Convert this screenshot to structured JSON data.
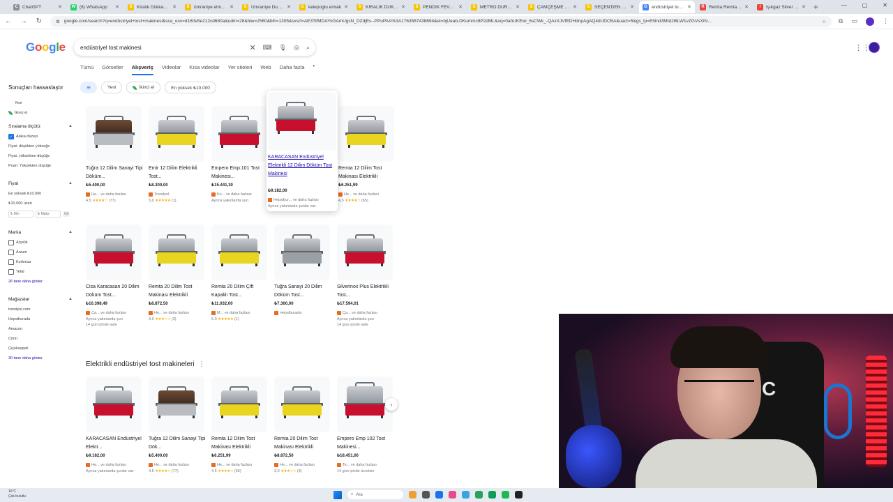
{
  "browser": {
    "tabs": [
      {
        "label": "ChatGPT",
        "color": "#8e8e8e",
        "glyph": "C"
      },
      {
        "label": "(8) WhatsApp",
        "color": "#25d366",
        "glyph": "W"
      },
      {
        "label": "Kiralık Dükkan &",
        "color": "#f5c400",
        "glyph": "S"
      },
      {
        "label": "ümraniye elmalık",
        "color": "#f5c400",
        "glyph": "S"
      },
      {
        "label": "Ümraniye Dumlu",
        "color": "#f5c400",
        "glyph": "S"
      },
      {
        "label": "kelepoglu emlak",
        "color": "#f5c400",
        "glyph": "S"
      },
      {
        "label": "KİRALIK DÜKKAN",
        "color": "#f5c400",
        "glyph": "S"
      },
      {
        "label": "PENDİK FEVZİ Ç",
        "color": "#f5c400",
        "glyph": "S"
      },
      {
        "label": "METRO DURAĞI",
        "color": "#f5c400",
        "glyph": "S"
      },
      {
        "label": "ÇAMÇEŞME MAH",
        "color": "#f5c400",
        "glyph": "S"
      },
      {
        "label": "SEÇEN'DEN MAĞ",
        "color": "#f5c400",
        "glyph": "S"
      },
      {
        "label": "endüstriyel tost n",
        "color": "#4285f4",
        "glyph": "G",
        "active": true
      },
      {
        "label": "Remta Remta Yo",
        "color": "#e8453c",
        "glyph": "R"
      },
      {
        "label": "Işıkgaz Silver End",
        "color": "#ea4335",
        "glyph": "I"
      }
    ],
    "url": "google.com/search?q=endüstriyel+tost+makinesi&sca_esv=d160e5e212cd680a&udm=28&biw=2560&bih=1305&sxsrf=AE3TifMDAYvGAmUgsN_DZdjEs--PPuPAA%3A1763587438694&ei=bjUeab-DKummc8P2dML&oq=0ahUKEwi_6sCWk_-QAxXJVfEDHdnpAgAQ4dUDCBA&uact=5&gs_lp=Ehlnd3Mtd2l6LW1vZGVsXIN..."
  },
  "search": {
    "query": "endüstriyel tost makinesi",
    "logo": [
      "G",
      "o",
      "o",
      "g",
      "l",
      "e"
    ],
    "logo_colors": [
      "#4285f4",
      "#ea4335",
      "#fbbc05",
      "#4285f4",
      "#34a853",
      "#ea4335"
    ]
  },
  "navtabs": [
    "Tümü",
    "Görseller",
    "Alışveriş",
    "Videolar",
    "Kısa videolar",
    "Yer siteleri",
    "Web",
    "Daha fazla"
  ],
  "navtabs_active": 2,
  "chips": [
    "Yeni",
    "İkinci el",
    "En yüksek ₺10.000"
  ],
  "sidebar": {
    "title": "Sonuçları hassaslaştır",
    "condition": [
      "Yeni",
      "İkinci el"
    ],
    "sort_heading": "Sıralama ölçütü:",
    "sort_options": [
      "Alaka düzeyi",
      "Fiyat: düşükten yükseğe",
      "Fiyat: yüksekten düşüğe",
      "Puan: Yüksekten düşüğe"
    ],
    "price_heading": "Fiyat",
    "price_options": [
      "En yüksek ₺10.000",
      "₺10.000 üzeri"
    ],
    "price_min": "₺ Min",
    "price_max": "₺ Maks",
    "price_go": "Git",
    "brand_heading": "Marka",
    "brands": [
      "Arçelik",
      "Arzum",
      "Korkmaz",
      "Tefal"
    ],
    "brands_more": "26 tane daha göster",
    "store_heading": "Mağazalar",
    "stores": [
      "trendyol.com",
      "Hepsiburada",
      "Amazon",
      "Cimri",
      "Çiçeksepeti"
    ],
    "stores_more": "30 tane daha göster"
  },
  "products_row1": [
    {
      "name": "Tuğra 12 Dilim Sanayi Tipi Döküm...",
      "price": "₺5.400,00",
      "store": "He... ve daha fazlası",
      "rating": "4,5",
      "stars": "★★★★☆",
      "count": "(77)",
      "style": "brown"
    },
    {
      "name": "Emir 12 Dilim Elektrikli Tost...",
      "price": "₺8.300,00",
      "store": "Trendyol",
      "rating": "5,0",
      "stars": "★★★★★",
      "count": "(1)",
      "style": "yellow"
    },
    {
      "name": "Empero Emp.101 Tost Makinesi...",
      "price": "₺15.441,30",
      "store": "Ko... ve daha fazlası",
      "rating": "",
      "stars": "",
      "count": "",
      "extra": "Ayrıca yakınlarda şun",
      "style": "red"
    },
    {
      "name": "KARACASAN Endüstriyel Elektrikli 12 Dilim Döküm Tost Makinesi",
      "price": "₺9.182,00",
      "store": "Hepsibur... ve daha fazlası",
      "rating": "",
      "stars": "",
      "count": "",
      "extra": "Ayrıca yakınlarda şunlar var:",
      "style": "red",
      "hover": true
    },
    {
      "name": "Remta 12 Dilim Tost Makinası Elektrikli",
      "price": "₺6.251,99",
      "store": "He... ve daha fazlası",
      "rating": "4,5",
      "stars": "★★★★☆",
      "count": "(65)",
      "style": "yellow"
    }
  ],
  "products_row2": [
    {
      "name": "Cisa Karacasan 20 Dilim Döküm Tost...",
      "price": "₺10.398,49",
      "store": "Ça... ve daha fazlası",
      "rating": "",
      "stars": "",
      "count": "",
      "extra": "Ayrıca yakınlarda şun",
      "extra2": "14 gün içinde iade",
      "style": "red"
    },
    {
      "name": "Remta 20 Dilim Tost Makinası Elektrikli",
      "price": "₺8.872,50",
      "store": "He... ve daha fazlası",
      "rating": "3,0",
      "stars": "★★★☆☆",
      "count": "(3)",
      "style": "yellow"
    },
    {
      "name": "Remta 20 Dilim Çift Kapaklı Tost...",
      "price": "₺11.032,00",
      "store": "M... ve daha fazlası",
      "rating": "5,0",
      "stars": "★★★★★",
      "count": "(1)",
      "style": "yellow"
    },
    {
      "name": "Tuğra Sanayi 20 Dilim Döküm Tost...",
      "price": "₺7.300,00",
      "store": "Hepsiburada",
      "rating": "",
      "stars": "",
      "count": "",
      "style": "silver"
    },
    {
      "name": "Silverinox Plus Elektrikli Tost...",
      "price": "₺17.594,01",
      "store": "Ça... ve daha fazlası",
      "rating": "",
      "stars": "",
      "count": "",
      "extra": "Ayrıca yakınlarda şun",
      "extra2": "14 gün içinde iade",
      "style": "red"
    }
  ],
  "section_title": "Elektrikli endüstriyel tost makineleri",
  "products_row3": [
    {
      "name": "KARACASAN Endüstriyel Elektr...",
      "price": "₺9.182,00",
      "store": "He... ve daha fazlası",
      "extra": "Ayrıca yakınlarda şunlar var:",
      "style": "red"
    },
    {
      "name": "Tuğra 12 Dilim Sanayi Tipi Dök...",
      "price": "₺5.400,00",
      "store": "He... ve daha fazlası",
      "rating": "4,5",
      "stars": "★★★★☆",
      "count": "(77)",
      "style": "brown"
    },
    {
      "name": "Remta 12 Dilim Tost Makinası Elektrikli",
      "price": "₺6.251,99",
      "store": "He... ve daha fazlası",
      "rating": "4,5",
      "stars": "★★★★☆",
      "count": "(65)",
      "style": "yellow"
    },
    {
      "name": "Remta 20 Dilim Tost Makinası Elektrikli",
      "price": "₺8.872,50",
      "store": "He... ve daha fazlası",
      "rating": "3,0",
      "stars": "★★★☆☆",
      "count": "(3)",
      "style": "yellow"
    },
    {
      "name": "Empero Emp 102 Tost Makinesi...",
      "price": "₺18.451,00",
      "store": "Te... ve daha fazlası",
      "extra": "14 gün içinde ücretsiz",
      "style": "red",
      "tall": true
    }
  ],
  "webcam": {
    "chair_text": "ALPC"
  },
  "taskbar": {
    "weather_temp": "16°C",
    "weather_desc": "Çok bulutlu",
    "search_placeholder": "Ara"
  }
}
